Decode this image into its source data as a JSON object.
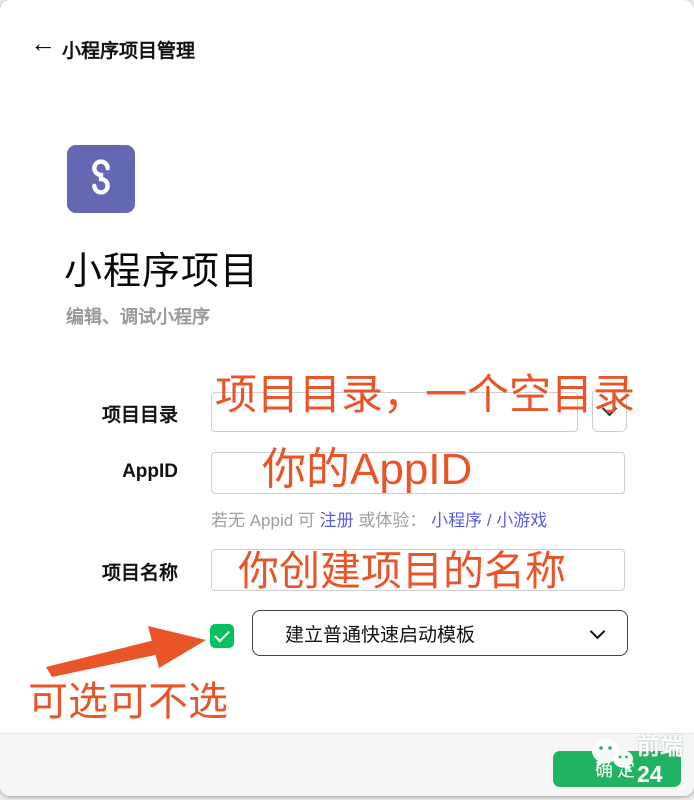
{
  "header": {
    "back_icon": "←",
    "title": "小程序项目管理"
  },
  "hero": {
    "title": "小程序项目",
    "subtitle": "编辑、调试小程序"
  },
  "form": {
    "project_dir": {
      "label": "项目目录"
    },
    "appid": {
      "label": "AppID",
      "helper": {
        "prefix": "若无 Appid 可 ",
        "register_link": "注册",
        "middle": " 或体验： ",
        "mini_program_link": "小程序",
        "separator": " / ",
        "mini_game_link": "小游戏"
      }
    },
    "project_name": {
      "label": "项目名称"
    },
    "template": {
      "checked": true,
      "select_value": "建立普通快速启动模板"
    }
  },
  "annotations": {
    "project_dir_note": "项目目录，一个空目录",
    "appid_note": "你的AppID",
    "project_name_note": "你创建项目的名称",
    "optional_note": "可选可不选"
  },
  "footer": {
    "confirm_label": "确定"
  },
  "watermark": {
    "text": "前端24"
  },
  "colors": {
    "accent_orange": "#e95428",
    "checkbox_green": "#07c160",
    "button_green": "#20b462",
    "logo_purple": "#6467b2",
    "link_blue": "#5a5fe0"
  }
}
